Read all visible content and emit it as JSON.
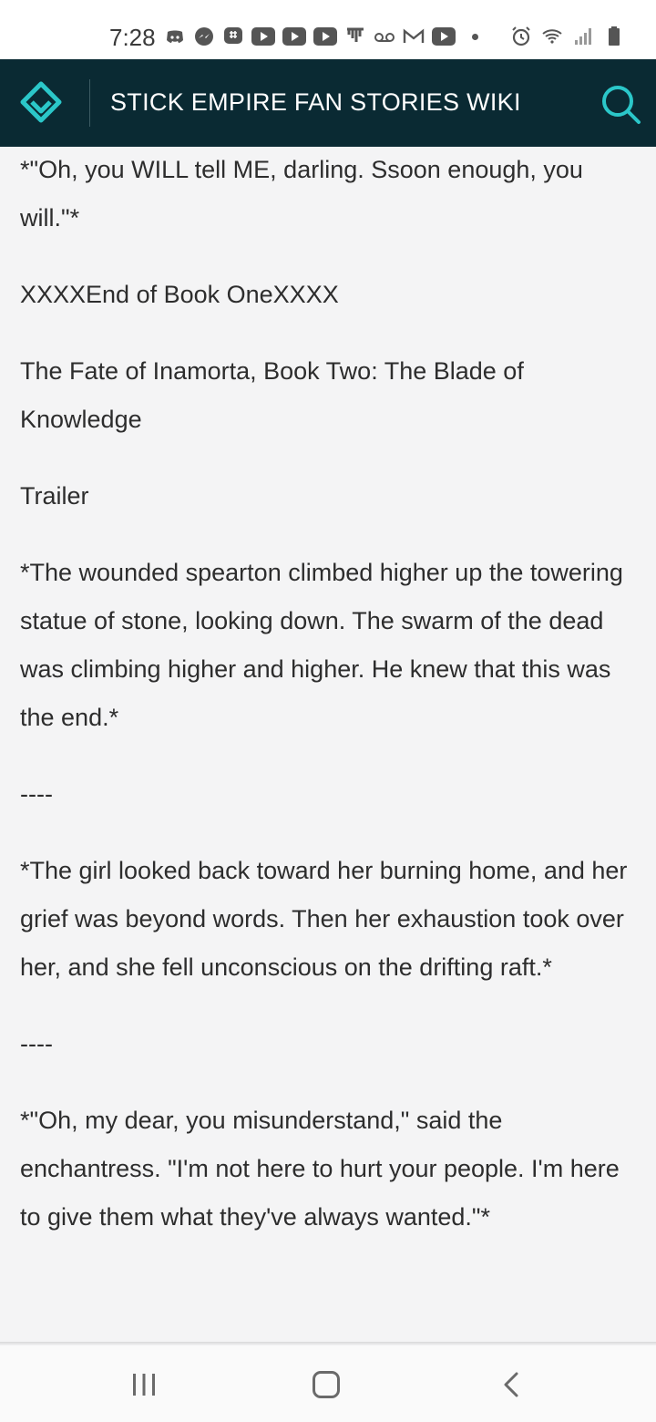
{
  "status_bar": {
    "time": "7:28",
    "left_icons": [
      "discord-icon",
      "messenger-icon",
      "groupme-icon",
      "youtube-icon",
      "youtube-icon",
      "youtube-icon",
      "patreon-icon",
      "voicemail-icon",
      "gmail-icon",
      "youtube-icon",
      "more-dot-icon"
    ],
    "right_icons": [
      "alarm-icon",
      "wifi-icon",
      "signal-icon",
      "battery-icon"
    ]
  },
  "header": {
    "title": "STICK EMPIRE FAN STORIES WIKI",
    "accent_color": "#2bc7c9",
    "background_color": "#0a2a33"
  },
  "content": {
    "paragraphs": [
      "*\"Oh, you WILL tell ME, darling. Ssoon enough, you will.\"*",
      "XXXXEnd of Book OneXXXX",
      "The Fate of Inamorta, Book Two: The Blade of Knowledge",
      "Trailer",
      "*The wounded spearton climbed higher up the towering statue of stone, looking down. The swarm of the dead was climbing higher and higher. He knew that this was the end.*",
      "----",
      "*The girl looked back toward her burning home, and her grief was beyond words. Then her exhaustion took over her, and she fell unconscious on the drifting raft.*",
      "----",
      "*\"Oh, my dear, you misunderstand,\" said the enchantress. \"I'm not here to hurt your people. I'm here to give them what they've always wanted.\"*"
    ]
  },
  "nav_bar": {
    "buttons": [
      "recents-icon",
      "home-icon",
      "back-icon"
    ]
  }
}
